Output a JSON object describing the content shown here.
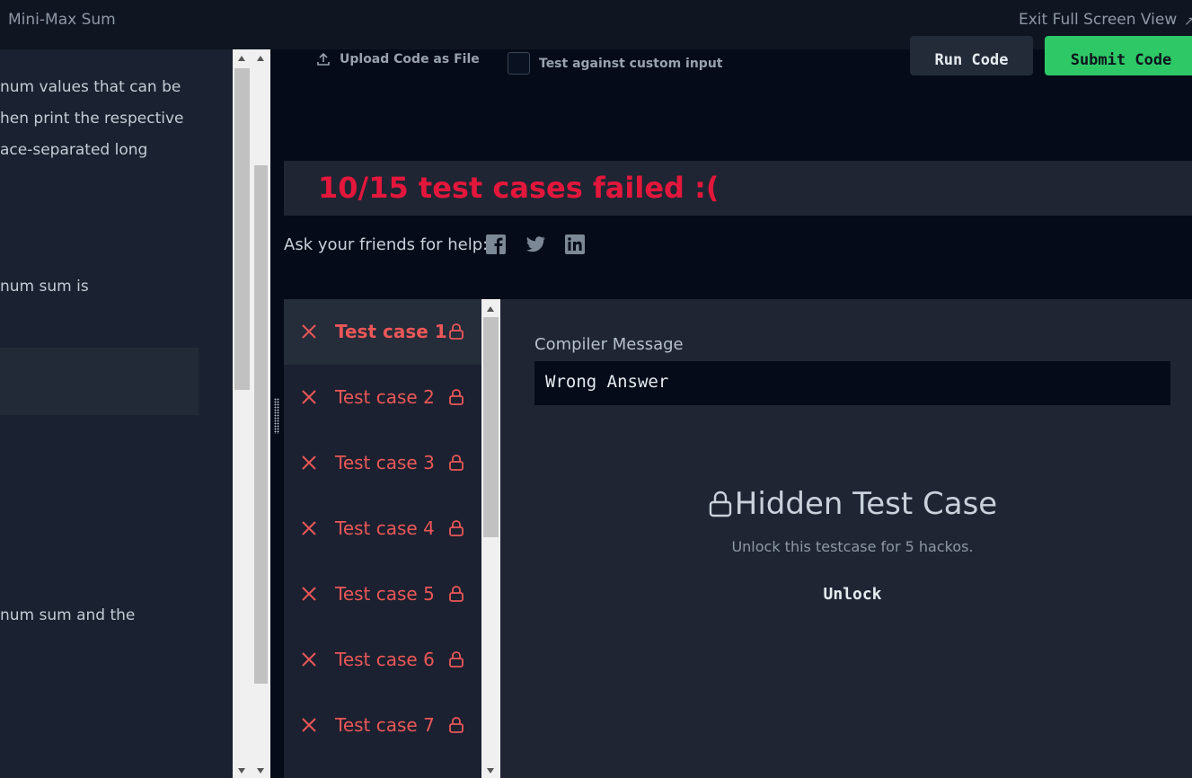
{
  "header": {
    "title": "Mini-Max Sum",
    "exit_label": "Exit Full Screen View"
  },
  "problem": {
    "lines": [
      "num values that can be",
      "hen print the respective",
      "ace-separated long",
      "num sum is",
      "num sum and the"
    ]
  },
  "editor": {
    "upload_label": "Upload Code as File",
    "custom_input_label": "Test against custom input",
    "run_label": "Run Code",
    "submit_label": "Submit Code"
  },
  "result": {
    "banner": "10/15 test cases failed :(",
    "ask_help": "Ask your friends for help:",
    "social": [
      "facebook-icon",
      "twitter-icon",
      "linkedin-icon"
    ]
  },
  "testcases": [
    {
      "label": "Test case 1"
    },
    {
      "label": "Test case 2"
    },
    {
      "label": "Test case 3"
    },
    {
      "label": "Test case 4"
    },
    {
      "label": "Test case 5"
    },
    {
      "label": "Test case 6"
    },
    {
      "label": "Test case 7"
    }
  ],
  "detail": {
    "compiler_label": "Compiler Message",
    "compiler_message": "Wrong Answer",
    "hidden_title": "Hidden Test Case",
    "hidden_sub": "Unlock this testcase for 5 hackos.",
    "unlock_label": "Unlock"
  },
  "colors": {
    "fail": "#eb5757",
    "banner_fail": "#e3173b",
    "submit": "#2ec866"
  }
}
